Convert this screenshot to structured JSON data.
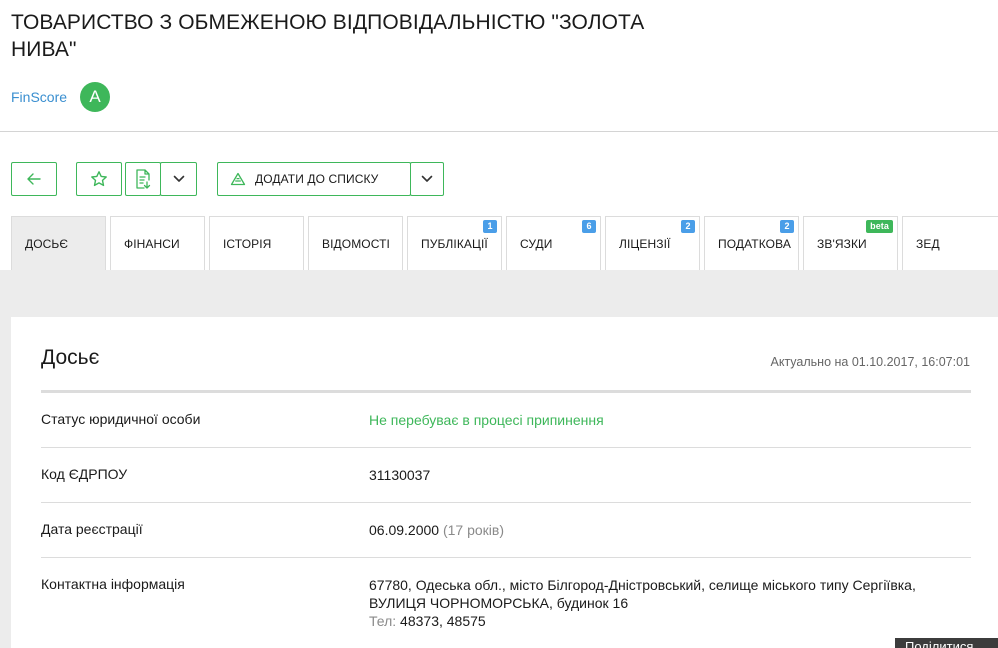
{
  "company": {
    "title": "ТОВАРИСТВО З ОБМЕЖЕНОЮ ВІДПОВІДАЛЬНІСТЮ \"ЗОЛОТА НИВА\"",
    "finscore_label": "FinScore",
    "finscore_grade": "A"
  },
  "toolbar": {
    "add_to_list_label": "ДОДАТИ ДО СПИСКУ"
  },
  "tabs": [
    {
      "label": "ДОСЬЄ",
      "badge": ""
    },
    {
      "label": "ФІНАНСИ",
      "badge": ""
    },
    {
      "label": "ІСТОРІЯ",
      "badge": ""
    },
    {
      "label": "ВІДОМОСТІ",
      "badge": ""
    },
    {
      "label": "ПУБЛІКАЦІЇ",
      "badge": "1"
    },
    {
      "label": "СУДИ",
      "badge": "6"
    },
    {
      "label": "ЛІЦЕНЗІЇ",
      "badge": "2"
    },
    {
      "label": "ПОДАТКОВА",
      "badge": "2"
    },
    {
      "label": "ЗВ'ЯЗКИ",
      "badge": "beta"
    },
    {
      "label": "ЗЕД",
      "badge": ""
    }
  ],
  "dossier": {
    "heading": "Досьє",
    "updated": "Актуально на 01.10.2017, 16:07:01",
    "status_key": "Статус юридичної особи",
    "status_value": "Не перебуває в процесі припинення",
    "edrpou_key": "Код ЄДРПОУ",
    "edrpou_value": "31130037",
    "reg_key": "Дата реєстрації",
    "reg_date": "06.09.2000",
    "reg_age": "(17 років)",
    "contact_key": "Контактна інформація",
    "address_line1": "67780, Одеська обл., місто Білгород-Дністровський, селище міського типу Сергіївка,",
    "address_line2": "ВУЛИЦЯ ЧОРНОМОРСЬКА, будинок 16",
    "phone_label": "Тел:",
    "phones": "48373, 48575"
  },
  "corner_widget": {
    "label": "Поділитися"
  },
  "colors": {
    "accent_green": "#3eb75a",
    "badge_blue": "#4a9ee8",
    "link_blue": "#3a8fd0"
  }
}
